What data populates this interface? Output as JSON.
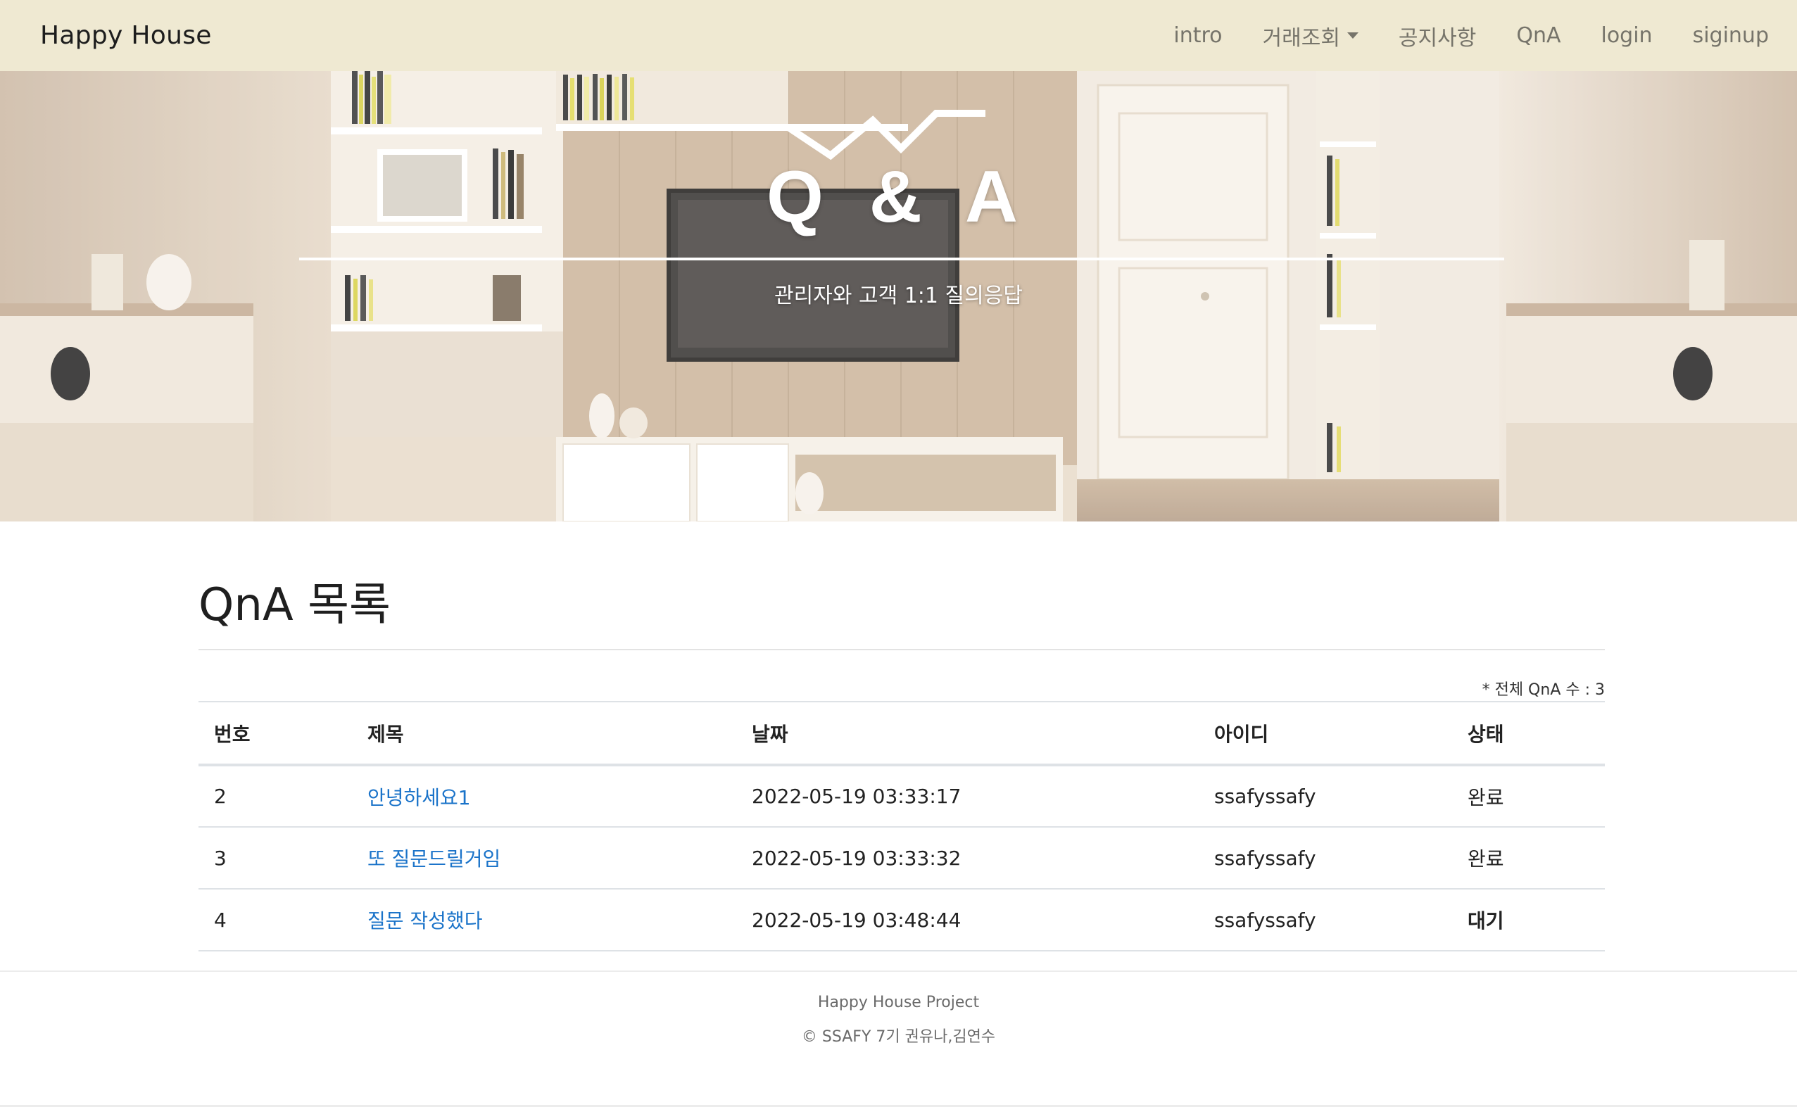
{
  "navbar": {
    "brand": "Happy House",
    "items": [
      {
        "label": "intro"
      },
      {
        "label": "거래조회",
        "dropdown": true
      },
      {
        "label": "공지사항"
      },
      {
        "label": "QnA"
      },
      {
        "label": "login"
      },
      {
        "label": "siginup"
      }
    ]
  },
  "hero": {
    "title": "Q & A",
    "subtitle": "관리자와 고객 1:1 질의응답"
  },
  "main": {
    "title": "QnA 목록",
    "total": "* 전체 QnA 수 : 3",
    "columns": [
      "번호",
      "제목",
      "날짜",
      "아이디",
      "상태"
    ],
    "rows": [
      {
        "no": "2",
        "title": "안녕하세요1",
        "date": "2022-05-19 03:33:17",
        "id": "ssafyssafy",
        "status": "완료"
      },
      {
        "no": "3",
        "title": "또 질문드릴거임",
        "date": "2022-05-19 03:33:32",
        "id": "ssafyssafy",
        "status": "완료"
      },
      {
        "no": "4",
        "title": "질문 작성했다",
        "date": "2022-05-19 03:48:44",
        "id": "ssafyssafy",
        "status": "대기"
      }
    ]
  },
  "footer": {
    "line1": "Happy House Project",
    "line2": "© SSAFY 7기 권유나,김연수"
  },
  "colors": {
    "navbar_bg": "#efe9d2",
    "link": "#1a73c9",
    "status_wait": "#8b1a1a"
  },
  "icons": {
    "dropdown": "caret-down-icon"
  }
}
